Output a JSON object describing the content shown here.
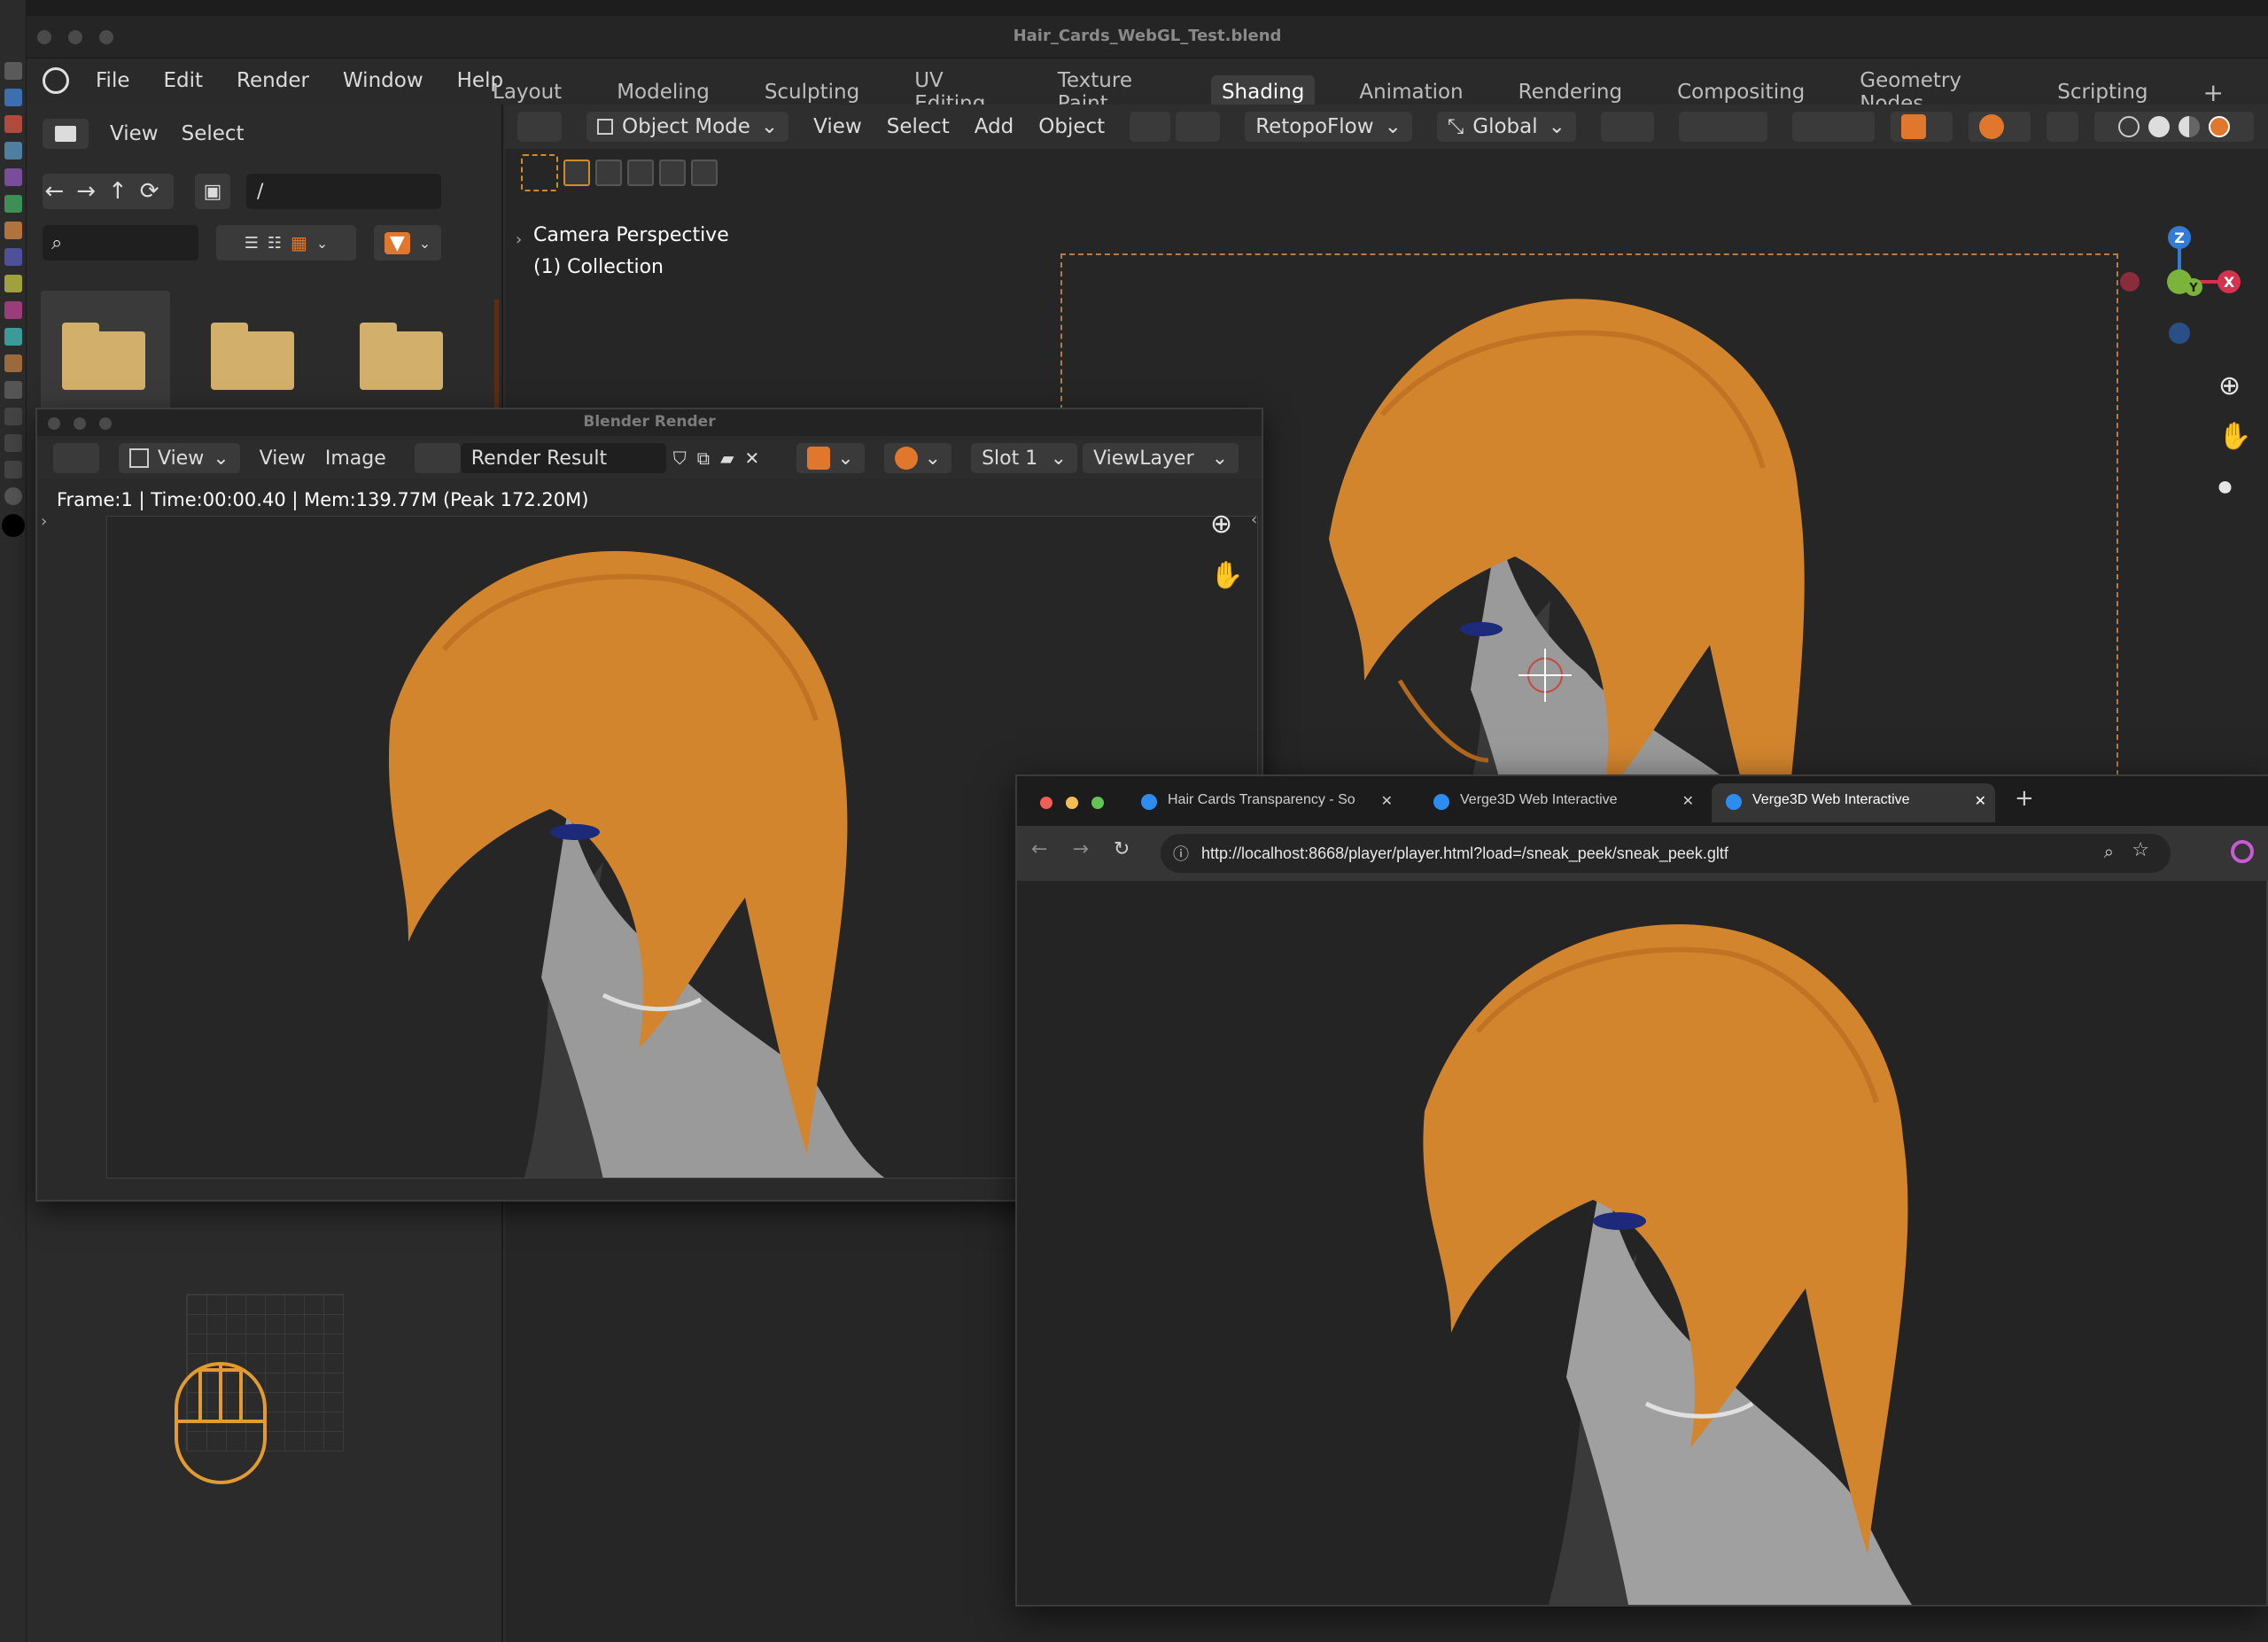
{
  "colors": {
    "accent_orange": "#e0772c",
    "hair": "#d3852e",
    "folder": "#d2b06b",
    "axis_z": "#2f7dd6",
    "axis_x": "#d5334d",
    "axis_y": "#7ab43a"
  },
  "blender": {
    "window_title": "Hair_Cards_WebGL_Test.blend",
    "menu": [
      "File",
      "Edit",
      "Render",
      "Window",
      "Help"
    ],
    "workspace_tabs": [
      "Layout",
      "Modeling",
      "Sculpting",
      "UV Editing",
      "Texture Paint",
      "Shading",
      "Animation",
      "Rendering",
      "Compositing",
      "Geometry Nodes",
      "Scripting"
    ],
    "active_tab": "Shading",
    "add_tab": "+",
    "file_browser": {
      "view": "View",
      "select": "Select",
      "path": "/",
      "nav_icons": [
        "back-arrow-icon",
        "forward-arrow-icon",
        "parent-dir-icon",
        "refresh-icon",
        "new-folder-icon"
      ],
      "folders": 3
    },
    "viewport": {
      "mode": "Object Mode",
      "menus": [
        "View",
        "Select",
        "Add",
        "Object"
      ],
      "addon": "RetopoFlow",
      "orientation": "Global",
      "overlay_label": "Camera Perspective",
      "collection_label": "(1) Collection",
      "gizmo": {
        "z": "Z",
        "x": "X",
        "y": "Y"
      }
    }
  },
  "render_window": {
    "title": "Blender Render",
    "view_menu": "View",
    "view": "View",
    "image": "Image",
    "image_name": "Render Result",
    "slot": "Slot 1",
    "layer": "ViewLayer",
    "stats": "Frame:1 | Time:00:00.40 | Mem:139.77M (Peak 172.20M)"
  },
  "browser": {
    "tabs": [
      {
        "label": "Hair Cards Transparency - So",
        "active": false
      },
      {
        "label": "Verge3D Web Interactive",
        "active": false
      },
      {
        "label": "Verge3D Web Interactive",
        "active": true
      }
    ],
    "new_tab": "+",
    "url": "http://localhost:8668/player/player.html?load=/sneak_peek/sneak_peek.gltf"
  }
}
